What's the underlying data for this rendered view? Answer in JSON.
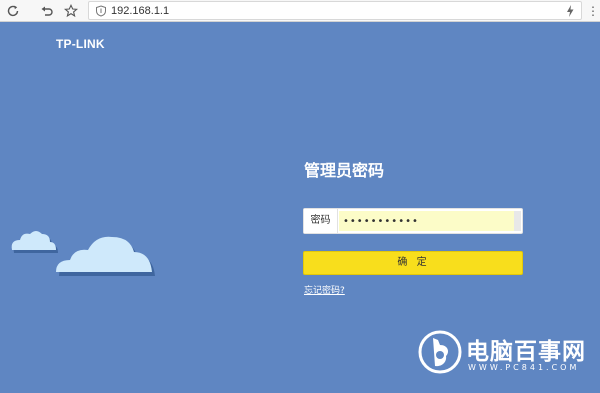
{
  "browser": {
    "url": "192.168.1.1",
    "icons": [
      "refresh-icon",
      "back-icon",
      "star-icon",
      "shield-icon",
      "bolt-icon",
      "more-icon"
    ]
  },
  "brand": {
    "logo": "TP-LINK"
  },
  "login": {
    "title": "管理员密码",
    "password_label": "密码",
    "password_value": "•••••••••••",
    "confirm_label": "确  定",
    "forgot_link": "忘记密码?"
  },
  "colors": {
    "background": "#5f86c2",
    "button": "#f8de1c",
    "input_bg": "#fcfcc8",
    "cloud": "#cfe9fb"
  },
  "watermark": {
    "name": "电脑百事网",
    "url": "WWW.PC841.COM"
  }
}
